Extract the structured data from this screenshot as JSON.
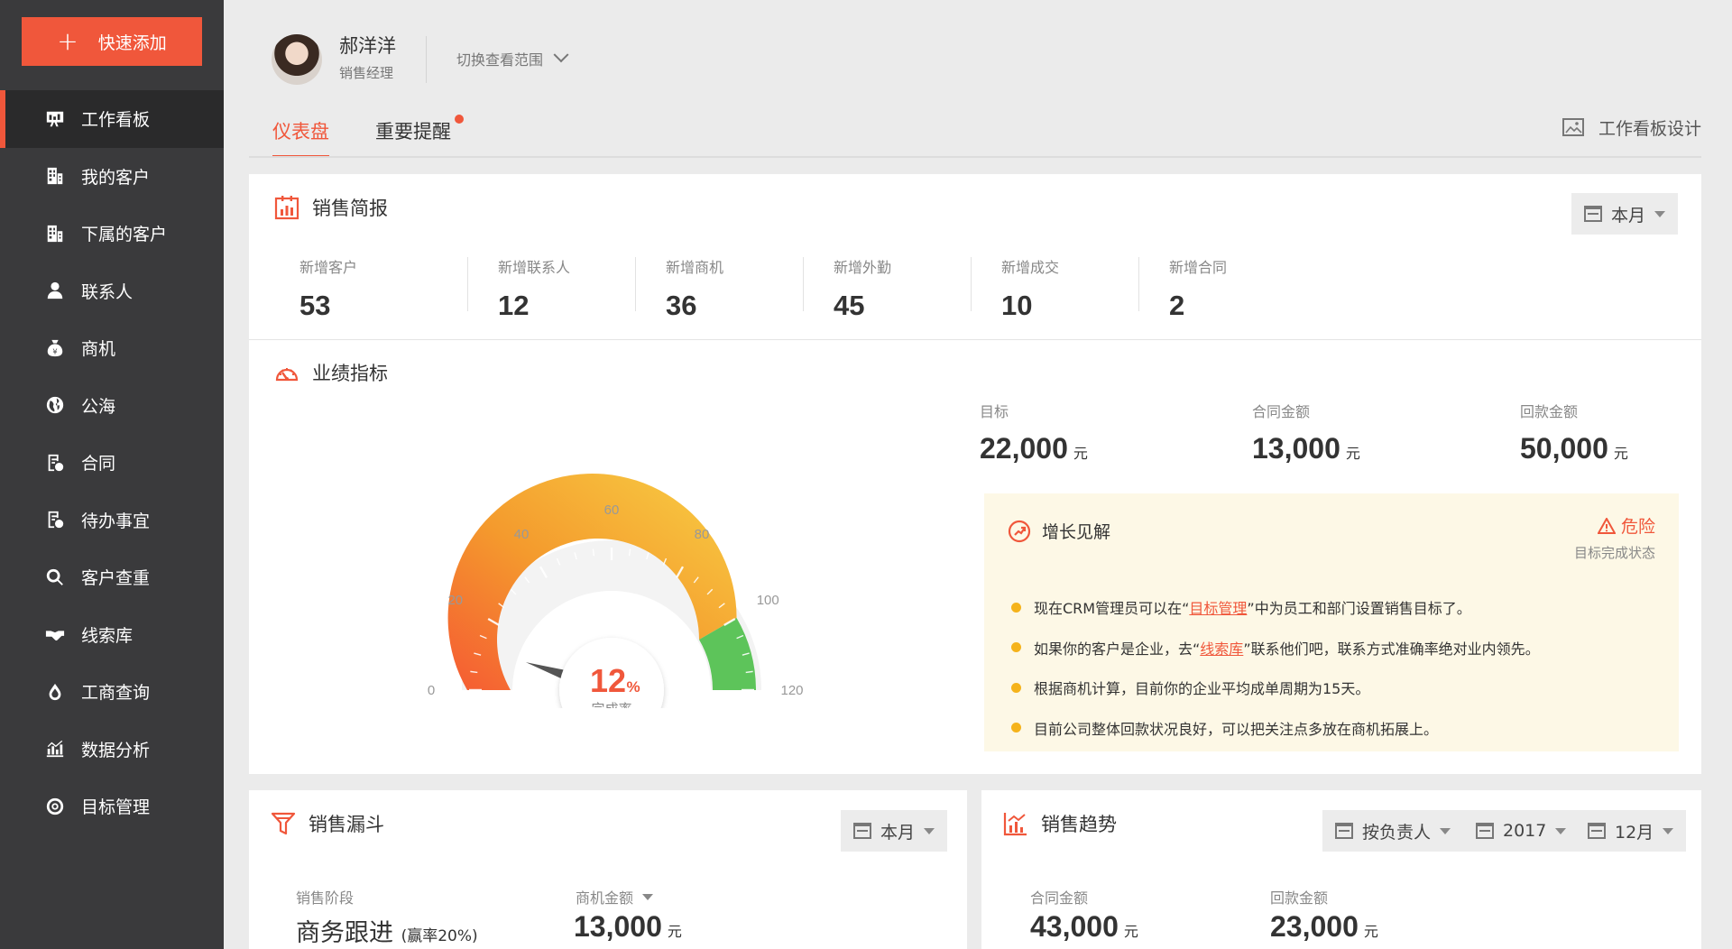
{
  "sidebar": {
    "quick_add": "快速添加",
    "items": [
      {
        "label": "工作看板",
        "icon": "board-icon"
      },
      {
        "label": "我的客户",
        "icon": "building-icon"
      },
      {
        "label": "下属的客户",
        "icon": "building-icon"
      },
      {
        "label": "联系人",
        "icon": "person-icon"
      },
      {
        "label": "商机",
        "icon": "money-bag-icon"
      },
      {
        "label": "公海",
        "icon": "globe-icon"
      },
      {
        "label": "合同",
        "icon": "contract-icon"
      },
      {
        "label": "待办事宜",
        "icon": "todo-icon"
      },
      {
        "label": "客户查重",
        "icon": "search-icon"
      },
      {
        "label": "线索库",
        "icon": "handshake-icon"
      },
      {
        "label": "工商查询",
        "icon": "drop-icon"
      },
      {
        "label": "数据分析",
        "icon": "chart-icon"
      },
      {
        "label": "目标管理",
        "icon": "target-icon"
      }
    ]
  },
  "header": {
    "user_name": "郝洋洋",
    "user_role": "销售经理",
    "scope": "切换查看范围",
    "tabs": {
      "dashboard": "仪表盘",
      "reminder": "重要提醒"
    },
    "board_design": "工作看板设计"
  },
  "sales_brief": {
    "title": "销售简报",
    "period": "本月",
    "stats": [
      {
        "label": "新增客户",
        "value": "53"
      },
      {
        "label": "新增联系人",
        "value": "12"
      },
      {
        "label": "新增商机",
        "value": "36"
      },
      {
        "label": "新增外勤",
        "value": "45"
      },
      {
        "label": "新增成交",
        "value": "10"
      },
      {
        "label": "新增合同",
        "value": "2"
      }
    ]
  },
  "performance": {
    "title": "业绩指标",
    "gauge": {
      "ticks": [
        "0",
        "20",
        "40",
        "60",
        "80",
        "100",
        "120"
      ],
      "value": 12,
      "value_text": "12",
      "unit": "%",
      "label": "完成率",
      "max": 120
    },
    "metrics": [
      {
        "label": "目标",
        "value": "22,000",
        "unit": "元"
      },
      {
        "label": "合同金额",
        "value": "13,000",
        "unit": "元"
      },
      {
        "label": "回款金额",
        "value": "50,000",
        "unit": "元"
      }
    ],
    "insight": {
      "title": "增长见解",
      "status": "危险",
      "status_sub": "目标完成状态",
      "tips": [
        {
          "pre": "现在CRM管理员可以在“",
          "link": "目标管理",
          "post": "”中为员工和部门设置销售目标了。"
        },
        {
          "pre": "如果你的客户是企业，去“",
          "link": "线索库",
          "post": "”联系他们吧，联系方式准确率绝对业内领先。"
        },
        {
          "pre": "根据商机计算，目前你的企业平均成单周期为15天。",
          "link": "",
          "post": ""
        },
        {
          "pre": "目前公司整体回款状况良好，可以把关注点多放在商机拓展上。",
          "link": "",
          "post": ""
        }
      ]
    }
  },
  "funnel": {
    "title": "销售漏斗",
    "period": "本月",
    "stage_label": "销售阶段",
    "stage_value": "商务跟进",
    "stage_rate": "(赢率20%)",
    "amount_label": "商机金额",
    "amount_value": "13,000",
    "amount_unit": "元"
  },
  "trend": {
    "title": "销售趋势",
    "filter_owner": "按负责人",
    "filter_year": "2017",
    "filter_month": "12月",
    "contract_label": "合同金额",
    "contract_value": "43,000",
    "contract_unit": "元",
    "payment_label": "回款金额",
    "payment_value": "23,000",
    "payment_unit": "元"
  },
  "colors": {
    "accent": "#f0573b",
    "sidebar": "#3a3a3c",
    "gauge_green": "#5dc45a",
    "gauge_yellow": "#f7c940",
    "gauge_orange": "#f48a2e",
    "tip_dot": "#f5b31b"
  }
}
